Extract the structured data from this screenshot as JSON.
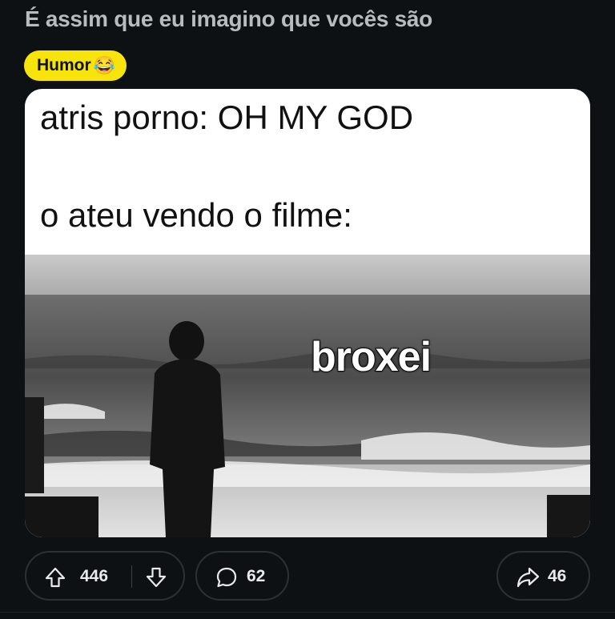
{
  "post": {
    "title": "É assim que eu imagino que vocês são",
    "flair": {
      "label": "Humor",
      "emoji": "😂",
      "color": "#f6e40a"
    },
    "media": {
      "caption_line_1": "atris porno: OH MY GOD",
      "caption_line_2": "o ateu vendo o filme:",
      "photo_overlay_text": "broxei",
      "photo_description_icon": "man-at-sea-photo"
    }
  },
  "actions": {
    "score": "446",
    "comments": "62",
    "shares": "46",
    "upvote_icon": "arrow-up-icon",
    "downvote_icon": "arrow-down-icon",
    "comment_icon": "speech-bubble-icon",
    "share_icon": "share-arrow-icon"
  },
  "colors": {
    "background": "#0e1113",
    "pill_border": "#2a3236",
    "title": "#b7bcbf"
  }
}
